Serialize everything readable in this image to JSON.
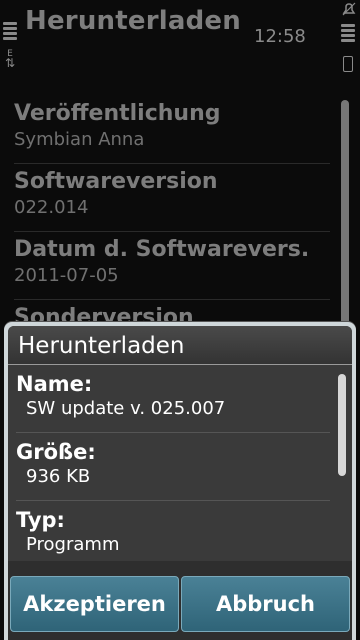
{
  "header": {
    "title": "Herunterladen",
    "clock": "12:58",
    "conn_label": "E"
  },
  "list": {
    "items": [
      {
        "label": "Veröffentlichung",
        "value": "Symbian Anna"
      },
      {
        "label": "Softwareversion",
        "value": "022.014"
      },
      {
        "label": "Datum d. Softwarevers.",
        "value": "2011-07-05"
      },
      {
        "label": "Sonderversion",
        "value": ""
      }
    ]
  },
  "dialog": {
    "title": "Herunterladen",
    "items": [
      {
        "label": "Name:",
        "value": "SW update v. 025.007"
      },
      {
        "label": "Größe:",
        "value": "936 KB"
      },
      {
        "label": "Typ:",
        "value": "Programm"
      }
    ],
    "accept_label": "Akzeptieren",
    "cancel_label": "Abbruch"
  },
  "colors": {
    "button": "#3b7389",
    "dialog_body": "#3a3a3a"
  }
}
